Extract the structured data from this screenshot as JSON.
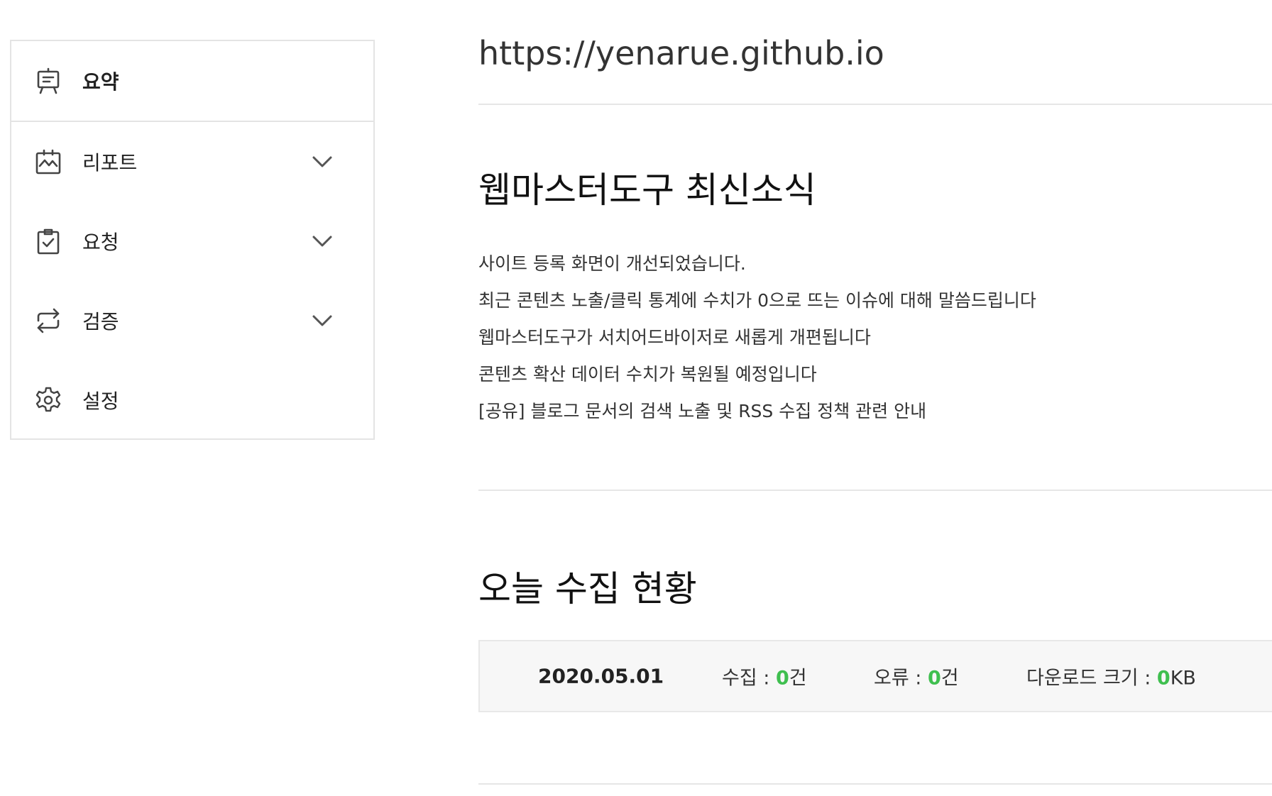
{
  "sidebar": {
    "items": [
      {
        "label": "요약",
        "icon": "presentation-board-icon",
        "expandable": false
      },
      {
        "label": "리포트",
        "icon": "report-chart-icon",
        "expandable": true
      },
      {
        "label": "요청",
        "icon": "clipboard-check-icon",
        "expandable": true
      },
      {
        "label": "검증",
        "icon": "repeat-arrows-icon",
        "expandable": true
      },
      {
        "label": "설정",
        "icon": "gear-icon",
        "expandable": false
      }
    ]
  },
  "main": {
    "site_url": "https://yenarue.github.io",
    "news": {
      "title": "웹마스터도구 최신소식",
      "items": [
        "사이트 등록 화면이 개선되었습니다.",
        "최근 콘텐츠 노출/클릭 통계에 수치가 0으로 뜨는 이슈에 대해 말씀드립니다",
        "웹마스터도구가 서치어드바이저로 새롭게 개편됩니다",
        "콘텐츠 확산 데이터 수치가 복원될 예정입니다",
        "[공유] 블로그 문서의 검색 노출 및 RSS 수집 정책 관련 안내"
      ]
    },
    "crawl": {
      "title": "오늘 수집 현황",
      "date": "2020.05.01",
      "collected_label": "수집 : ",
      "collected_value": "0",
      "collected_unit": "건",
      "error_label": "오류 : ",
      "error_value": "0",
      "error_unit": "건",
      "download_label": "다운로드 크기 : ",
      "download_value": "0",
      "download_unit": "KB"
    }
  },
  "colors": {
    "accent_green": "#3fbf4f",
    "border": "#e4e4e4",
    "stats_bg": "#f7f7f7"
  }
}
